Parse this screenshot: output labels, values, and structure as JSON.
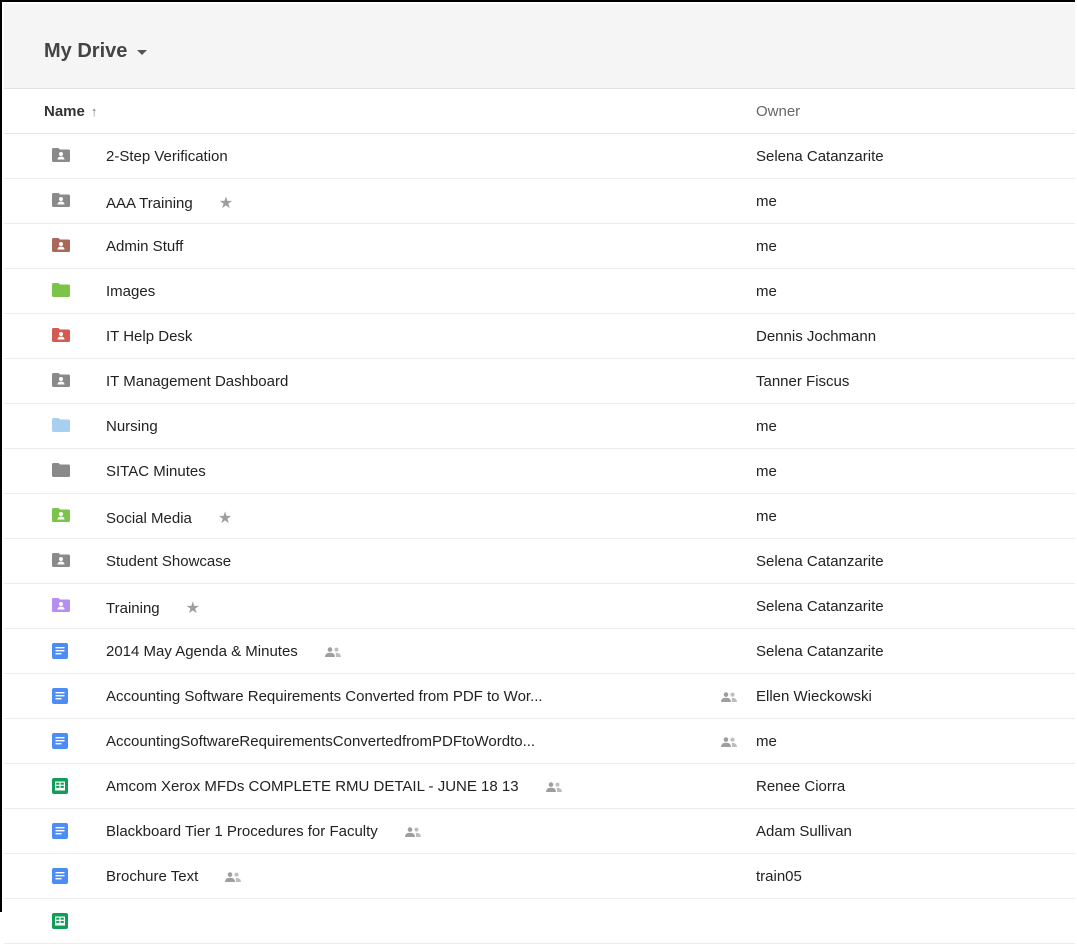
{
  "header": {
    "title": "My Drive"
  },
  "columns": {
    "name": "Name",
    "sort_arrow": "↑",
    "owner": "Owner"
  },
  "colors": {
    "folder_gray": "#8a8a8a",
    "folder_brown": "#a8695a",
    "folder_green": "#7cc34a",
    "folder_red": "#d45b50",
    "folder_lightblue": "#a6cff0",
    "folder_purple": "#b48ef0",
    "doc_blue": "#4b8cf5",
    "sheet_green": "#0f9d58"
  },
  "rows": [
    {
      "name": "2-Step Verification",
      "owner": "Selena Catanzarite",
      "icon": "shared-folder-icon",
      "color": "folder_gray"
    },
    {
      "name": "AAA Training",
      "owner": "me",
      "icon": "shared-folder-icon",
      "color": "folder_gray",
      "starred": true
    },
    {
      "name": "Admin Stuff",
      "owner": "me",
      "icon": "shared-folder-icon",
      "color": "folder_brown"
    },
    {
      "name": "Images",
      "owner": "me",
      "icon": "folder-icon",
      "color": "folder_green"
    },
    {
      "name": "IT Help Desk",
      "owner": "Dennis Jochmann",
      "icon": "shared-folder-icon",
      "color": "folder_red"
    },
    {
      "name": "IT Management Dashboard",
      "owner": "Tanner Fiscus",
      "icon": "shared-folder-icon",
      "color": "folder_gray"
    },
    {
      "name": "Nursing",
      "owner": "me",
      "icon": "folder-icon",
      "color": "folder_lightblue"
    },
    {
      "name": "SITAC Minutes",
      "owner": "me",
      "icon": "folder-icon",
      "color": "folder_gray"
    },
    {
      "name": "Social Media",
      "owner": "me",
      "icon": "shared-folder-icon",
      "color": "folder_green",
      "starred": true
    },
    {
      "name": "Student Showcase",
      "owner": "Selena Catanzarite",
      "icon": "shared-folder-icon",
      "color": "folder_gray"
    },
    {
      "name": "Training",
      "owner": "Selena Catanzarite",
      "icon": "shared-folder-icon",
      "color": "folder_purple",
      "starred": true
    },
    {
      "name": "2014 May Agenda & Minutes",
      "owner": "Selena Catanzarite",
      "icon": "doc-icon",
      "color": "doc_blue",
      "shared": "inline"
    },
    {
      "name": "Accounting Software Requirements Converted from PDF to Wor...",
      "owner": "Ellen Wieckowski",
      "icon": "doc-icon",
      "color": "doc_blue",
      "shared": "right"
    },
    {
      "name": "AccountingSoftwareRequirementsConvertedfromPDFtoWordto...",
      "owner": "me",
      "icon": "doc-icon",
      "color": "doc_blue",
      "shared": "right"
    },
    {
      "name": "Amcom Xerox MFDs COMPLETE RMU DETAIL - JUNE 18 13",
      "owner": "Renee Ciorra",
      "icon": "sheet-icon",
      "color": "sheet_green",
      "shared": "inline"
    },
    {
      "name": "Blackboard Tier 1 Procedures for Faculty",
      "owner": "Adam Sullivan",
      "icon": "doc-icon",
      "color": "doc_blue",
      "shared": "inline"
    },
    {
      "name": "Brochure Text",
      "owner": "train05",
      "icon": "doc-icon",
      "color": "doc_blue",
      "shared": "inline"
    },
    {
      "name": "",
      "owner": "",
      "icon": "sheet-icon",
      "color": "sheet_green"
    }
  ],
  "star_glyph": "★"
}
